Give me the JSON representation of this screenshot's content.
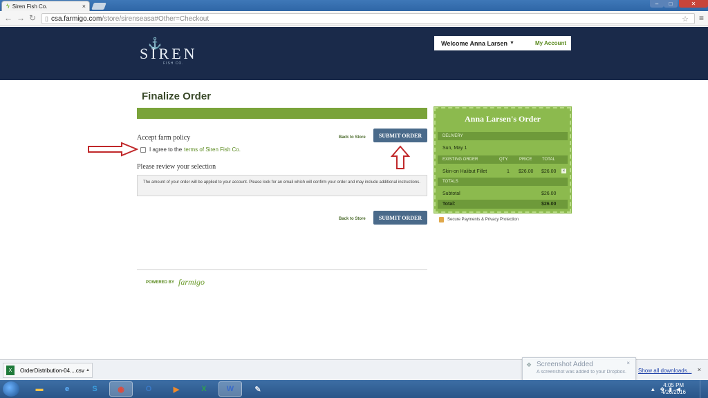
{
  "browser": {
    "tab_title": "Siren Fish Co.",
    "tab_close": "×",
    "url_host": "csa.farmigo.com",
    "url_path": "/store/sirenseasa#Other=Checkout"
  },
  "header": {
    "logo_text": "SIREN",
    "logo_sub": "FISH CO.",
    "welcome": "Welcome Anna Larsen",
    "my_account": "My Account"
  },
  "main": {
    "title": "Finalize Order",
    "policy_heading": "Accept farm policy",
    "agree_text": "I agree to the",
    "terms_link": "terms of Siren Fish Co.",
    "review_heading": "Please review your selection",
    "info_text": "The amount of your order will be applied to your account. Please look for an email which will confirm your order and may include additional instructions.",
    "back_to_store": "Back to Store",
    "submit_order": "SUBMIT ORDER",
    "powered_by": "POWERED BY",
    "farmigo": "farmigo"
  },
  "order": {
    "title": "Anna Larsen's Order",
    "delivery_header": "DELIVERY",
    "delivery_date": "Sun, May 1",
    "existing_header": "EXISTING ORDER",
    "qty_header": "QTY.",
    "price_header": "PRICE",
    "total_header": "TOTAL",
    "items": [
      {
        "name": "Skin-on Halibut Fillet",
        "qty": "1",
        "price": "$26.00",
        "total": "$26.00"
      }
    ],
    "totals_header": "TOTALS",
    "subtotal_label": "Subtotal",
    "subtotal_value": "$26.00",
    "total_label": "Total:",
    "total_value": "$26.00",
    "secure_text": "Secure Payments & Privacy Protection"
  },
  "downloads": {
    "file_name": "OrderDistribution-04....csv",
    "show_all": "Show all downloads...",
    "close": "×"
  },
  "toast": {
    "title": "Screenshot Added",
    "subtitle": "A screenshot was added to your Dropbox."
  },
  "taskbar": {
    "time": "4:05 PM",
    "date": "4/26/2016"
  },
  "colors": {
    "header_bg": "#1a2a4a",
    "accent_green": "#7aa33a",
    "button_blue": "#4a6a8a",
    "annotation_red": "#c0282a"
  }
}
